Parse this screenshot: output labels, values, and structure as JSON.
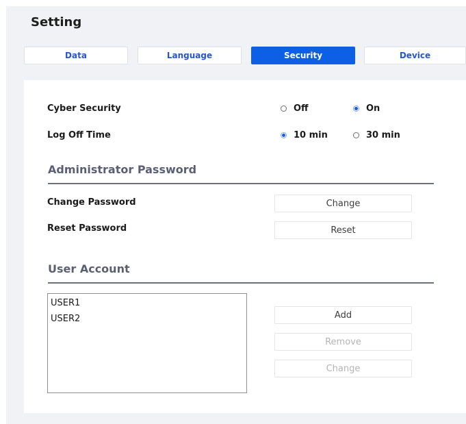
{
  "header": {
    "title": "Setting"
  },
  "tabs": [
    {
      "label": "Data",
      "active": false
    },
    {
      "label": "Language",
      "active": false
    },
    {
      "label": "Security",
      "active": true
    },
    {
      "label": "Device",
      "active": false
    }
  ],
  "security": {
    "cyber_security": {
      "label": "Cyber Security",
      "options": [
        "Off",
        "On"
      ],
      "selected": "On"
    },
    "log_off_time": {
      "label": "Log Off Time",
      "options": [
        "10 min",
        "30 min"
      ],
      "selected": "10 min"
    }
  },
  "admin_password": {
    "title": "Administrator Password",
    "change_label": "Change Password",
    "change_button": "Change",
    "reset_label": "Reset Password",
    "reset_button": "Reset"
  },
  "user_account": {
    "title": "User Account",
    "users": [
      "USER1",
      "USER2"
    ],
    "add_button": "Add",
    "remove_button": "Remove",
    "change_button": "Change"
  },
  "colors": {
    "accent": "#0d5fe6",
    "tab_text": "#2356d6",
    "section_title": "#5a5f73",
    "background": "#f1f2f5"
  }
}
